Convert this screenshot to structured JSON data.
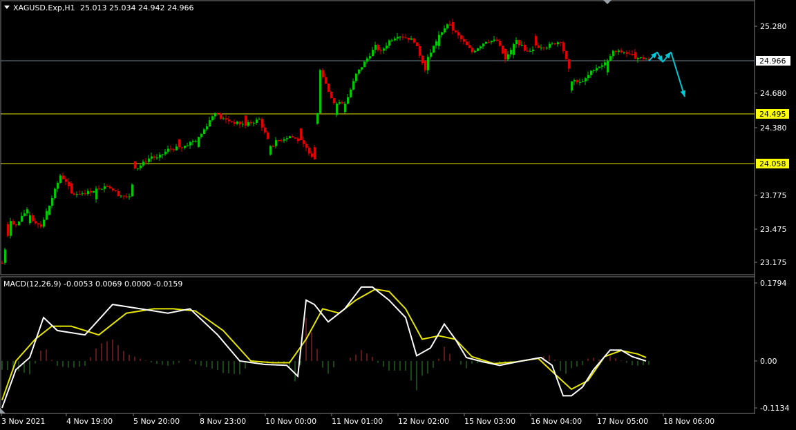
{
  "header": {
    "symbol": "XAGUSD.Exp,H1",
    "ohlc": "25.013 25.034 24.942 24.966"
  },
  "macd_header": "MACD(12,26,9) -0.0053 0.0069 0.0000 -0.0159",
  "colors": {
    "background": "#000000",
    "bull": "#00c800",
    "bear": "#e00000",
    "grid_line": "#708090",
    "support_line": "#e6e600",
    "label_bg_yellow": "#ffff00",
    "arrow": "#00c8d8",
    "macd_main": "#ffffff",
    "macd_signal": "#e6e600",
    "hist_pos": "#c03030",
    "hist_neg": "#2f8f2f"
  },
  "chart_data": [
    {
      "type": "candlestick",
      "symbol": "XAGUSD.Exp",
      "timeframe": "H1",
      "y_tick_labels": [
        "25.280",
        "24.680",
        "24.380",
        "23.775",
        "23.475",
        "23.175"
      ],
      "ylim": [
        23.13,
        25.35
      ],
      "levels": [
        {
          "price": "24.966",
          "kind": "current"
        },
        {
          "price": "24.495",
          "kind": "horizontal"
        },
        {
          "price": "24.058",
          "kind": "horizontal"
        }
      ],
      "x_tick_labels": [
        "3 Nov 2021",
        "4 Nov 19:00",
        "5 Nov 20:00",
        "8 Nov 23:00",
        "10 Nov 00:00",
        "11 Nov 01:00",
        "12 Nov 02:00",
        "15 Nov 03:00",
        "16 Nov 04:00",
        "17 Nov 05:00",
        "18 Nov 06:00"
      ],
      "close_path": [
        [
          0,
          23.17
        ],
        [
          3,
          23.55
        ],
        [
          5,
          23.5
        ],
        [
          9,
          23.65
        ],
        [
          11,
          23.55
        ],
        [
          14,
          23.5
        ],
        [
          18,
          23.75
        ],
        [
          21,
          23.95
        ],
        [
          23,
          23.9
        ],
        [
          25,
          23.78
        ],
        [
          31,
          23.8
        ],
        [
          38,
          23.86
        ],
        [
          42,
          23.78
        ],
        [
          46,
          23.75
        ],
        [
          48,
          24.0
        ],
        [
          54,
          24.12
        ],
        [
          56,
          24.1
        ],
        [
          60,
          24.18
        ],
        [
          65,
          24.2
        ],
        [
          71,
          24.28
        ],
        [
          77,
          24.52
        ],
        [
          79,
          24.46
        ],
        [
          84,
          24.42
        ],
        [
          88,
          24.4
        ],
        [
          93,
          24.45
        ],
        [
          97,
          24.2
        ],
        [
          99,
          24.25
        ],
        [
          104,
          24.3
        ],
        [
          108,
          24.25
        ],
        [
          113,
          24.1
        ],
        [
          115,
          24.9
        ],
        [
          118,
          24.7
        ],
        [
          120,
          24.6
        ],
        [
          124,
          24.58
        ],
        [
          128,
          24.85
        ],
        [
          135,
          25.1
        ],
        [
          137,
          25.05
        ],
        [
          140,
          25.15
        ],
        [
          143,
          25.2
        ],
        [
          146,
          25.18
        ],
        [
          149,
          25.15
        ],
        [
          153,
          24.9
        ],
        [
          154,
          25.0
        ],
        [
          158,
          25.2
        ],
        [
          161,
          25.3
        ],
        [
          164,
          25.22
        ],
        [
          170,
          25.05
        ],
        [
          175,
          25.15
        ],
        [
          179,
          25.15
        ],
        [
          182,
          24.98
        ],
        [
          186,
          25.15
        ],
        [
          190,
          25.05
        ],
        [
          193,
          25.1
        ],
        [
          197,
          25.1
        ],
        [
          202,
          25.15
        ],
        [
          206,
          24.8
        ],
        [
          210,
          24.78
        ],
        [
          214,
          24.9
        ],
        [
          218,
          24.95
        ],
        [
          221,
          25.05
        ],
        [
          225,
          25.05
        ],
        [
          229,
          25.0
        ],
        [
          233,
          24.99
        ],
        [
          234,
          24.97
        ]
      ],
      "projection": [
        [
          234,
          24.97
        ],
        [
          237,
          25.05
        ],
        [
          239,
          24.96
        ],
        [
          242,
          25.05
        ],
        [
          247,
          24.65
        ]
      ],
      "bullish_bars": [
        10,
        17,
        34,
        71,
        97,
        114,
        121,
        124,
        158,
        185,
        206,
        219
      ],
      "bearish_bars": [
        2,
        25,
        48,
        64,
        88,
        108,
        113,
        153,
        163,
        182,
        193,
        229
      ]
    },
    {
      "type": "macd",
      "params": "12,26,9",
      "values": {
        "histogram": -0.0053,
        "signal": 0.0069,
        "third": 0.0,
        "fourth": -0.0159
      },
      "y_tick_labels": [
        "0.1794",
        "0.00",
        "-0.1134"
      ],
      "ylim": [
        -0.1134,
        0.1794
      ],
      "main_path": [
        [
          0,
          -0.108
        ],
        [
          5,
          -0.02
        ],
        [
          10,
          0.008
        ],
        [
          15,
          0.1
        ],
        [
          20,
          0.07
        ],
        [
          30,
          0.06
        ],
        [
          40,
          0.13
        ],
        [
          50,
          0.12
        ],
        [
          60,
          0.11
        ],
        [
          68,
          0.12
        ],
        [
          78,
          0.06
        ],
        [
          86,
          0.0
        ],
        [
          95,
          -0.008
        ],
        [
          103,
          -0.01
        ],
        [
          107,
          -0.035
        ],
        [
          110,
          0.14
        ],
        [
          113,
          0.13
        ],
        [
          118,
          0.09
        ],
        [
          124,
          0.12
        ],
        [
          130,
          0.17
        ],
        [
          134,
          0.17
        ],
        [
          140,
          0.14
        ],
        [
          146,
          0.1
        ],
        [
          150,
          0.012
        ],
        [
          155,
          0.03
        ],
        [
          160,
          0.085
        ],
        [
          164,
          0.05
        ],
        [
          168,
          0.008
        ],
        [
          174,
          -0.002
        ],
        [
          180,
          -0.01
        ],
        [
          188,
          0.0
        ],
        [
          195,
          0.008
        ],
        [
          199,
          -0.01
        ],
        [
          203,
          -0.08
        ],
        [
          206,
          -0.08
        ],
        [
          210,
          -0.06
        ],
        [
          214,
          -0.02
        ],
        [
          220,
          0.025
        ],
        [
          224,
          0.025
        ],
        [
          228,
          0.01
        ],
        [
          233,
          0.0
        ]
      ],
      "signal_path": [
        [
          0,
          -0.09
        ],
        [
          5,
          0.0
        ],
        [
          12,
          0.05
        ],
        [
          18,
          0.08
        ],
        [
          25,
          0.08
        ],
        [
          35,
          0.06
        ],
        [
          45,
          0.11
        ],
        [
          55,
          0.12
        ],
        [
          62,
          0.12
        ],
        [
          70,
          0.115
        ],
        [
          80,
          0.07
        ],
        [
          90,
          0.0
        ],
        [
          98,
          -0.004
        ],
        [
          104,
          -0.004
        ],
        [
          110,
          0.05
        ],
        [
          116,
          0.12
        ],
        [
          122,
          0.11
        ],
        [
          128,
          0.14
        ],
        [
          135,
          0.165
        ],
        [
          140,
          0.16
        ],
        [
          146,
          0.12
        ],
        [
          152,
          0.05
        ],
        [
          158,
          0.058
        ],
        [
          164,
          0.05
        ],
        [
          170,
          0.01
        ],
        [
          178,
          -0.006
        ],
        [
          186,
          -0.002
        ],
        [
          194,
          0.006
        ],
        [
          200,
          -0.03
        ],
        [
          206,
          -0.065
        ],
        [
          212,
          -0.045
        ],
        [
          218,
          0.01
        ],
        [
          224,
          0.024
        ],
        [
          230,
          0.016
        ],
        [
          233,
          0.008
        ]
      ]
    }
  ]
}
